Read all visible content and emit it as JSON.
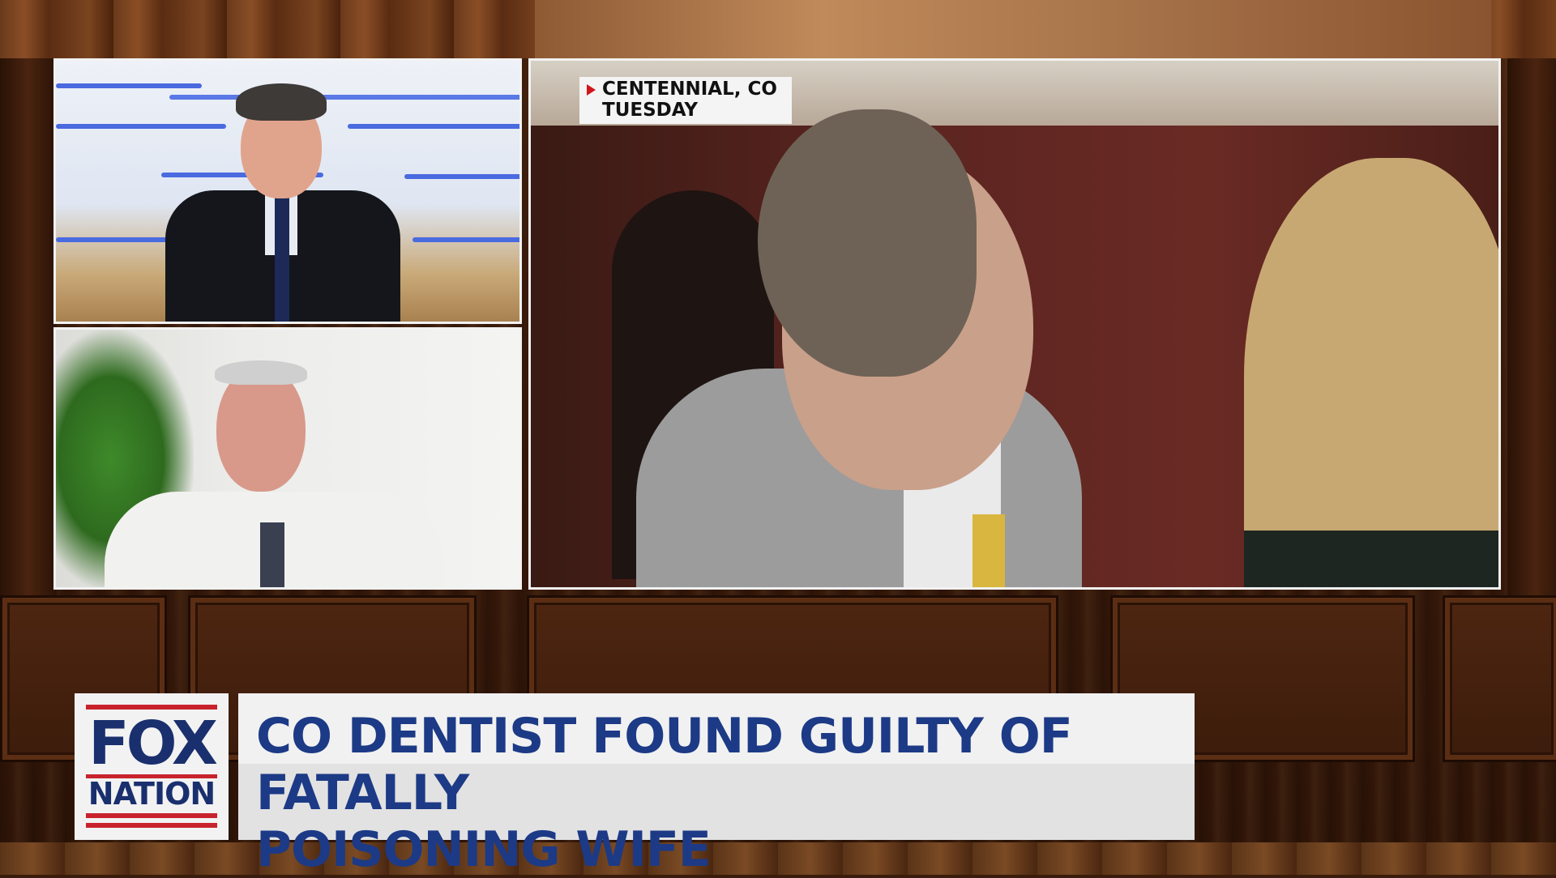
{
  "location": {
    "line1": "CENTENNIAL, CO",
    "line2": "TUESDAY"
  },
  "lower_third": {
    "logo_top": "FOX",
    "logo_bottom": "NATION",
    "headline_line1": "CO DENTIST FOUND GUILTY OF FATALLY",
    "headline_line2": "POISONING WIFE"
  },
  "colors": {
    "headline_text": "#1c3a86",
    "logo_blue": "#1a2f6e",
    "logo_red": "#c8232c",
    "tag_marker": "#d0161b"
  }
}
